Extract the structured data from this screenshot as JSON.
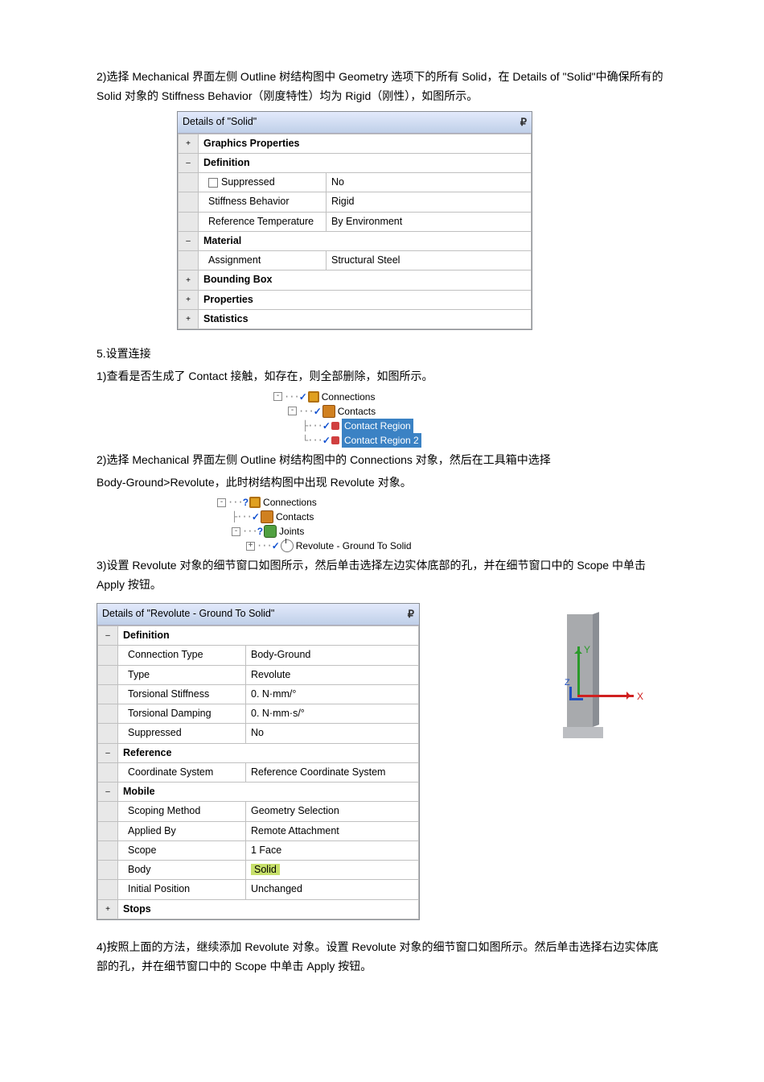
{
  "para1": "2)选择 Mechanical 界面左侧 Outline 树结构图中 Geometry 选项下的所有 Solid，在 Details of \"Solid\"中确保所有的 Solid 对象的 Stiffness Behavior（刚度特性）均为 Rigid（刚性），如图所示。",
  "panel1": {
    "title": "Details of \"Solid\"",
    "groups": {
      "graphics": "Graphics Properties",
      "definition": "Definition",
      "material": "Material",
      "bounding": "Bounding Box",
      "properties": "Properties",
      "statistics": "Statistics"
    },
    "rows": {
      "suppressed": {
        "label": "Suppressed",
        "val": "No"
      },
      "stiffness": {
        "label": "Stiffness Behavior",
        "val": "Rigid"
      },
      "reftemp": {
        "label": "Reference Temperature",
        "val": "By Environment"
      },
      "assignment": {
        "label": "Assignment",
        "val": "Structural Steel"
      }
    }
  },
  "heading5": "5.设置连接",
  "para5_1": "1)查看是否生成了 Contact 接触，如存在，则全部删除，如图所示。",
  "tree1": {
    "n1": "Connections",
    "n2": "Contacts",
    "n3": "Contact Region",
    "n4": "Contact Region 2"
  },
  "para5_2a": "2)选择 Mechanical 界面左侧 Outline 树结构图中的 Connections 对象，然后在工具箱中选择",
  "para5_2b": "Body-Ground>Revolute，此时树结构图中出现 Revolute 对象。",
  "tree2": {
    "n1": "Connections",
    "n2": "Contacts",
    "n3": "Joints",
    "n4": "Revolute - Ground To Solid"
  },
  "para5_3": "3)设置 Revolute 对象的细节窗口如图所示，然后单击选择左边实体底部的孔，并在细节窗口中的 Scope 中单击 Apply 按钮。",
  "panel2": {
    "title": "Details of \"Revolute - Ground To Solid\"",
    "groups": {
      "definition": "Definition",
      "reference": "Reference",
      "mobile": "Mobile",
      "stops": "Stops"
    },
    "rows": {
      "conntype": {
        "label": "Connection Type",
        "val": "Body-Ground"
      },
      "type": {
        "label": "Type",
        "val": "Revolute"
      },
      "torstiff": {
        "label": "Torsional Stiffness",
        "val": "0. N·mm/°"
      },
      "tordamp": {
        "label": "Torsional Damping",
        "val": "0. N·mm·s/°"
      },
      "suppressed": {
        "label": "Suppressed",
        "val": "No"
      },
      "coord": {
        "label": "Coordinate System",
        "val": "Reference Coordinate System"
      },
      "scopemethod": {
        "label": "Scoping Method",
        "val": "Geometry Selection"
      },
      "appliedby": {
        "label": "Applied By",
        "val": "Remote Attachment"
      },
      "scope": {
        "label": "Scope",
        "val": "1 Face"
      },
      "body": {
        "label": "Body",
        "val": "Solid"
      },
      "initpos": {
        "label": "Initial Position",
        "val": "Unchanged"
      }
    }
  },
  "axis": {
    "x": "X",
    "y": "Y",
    "z": "Z"
  },
  "para5_4": "4)按照上面的方法，继续添加 Revolute 对象。设置 Revolute 对象的细节窗口如图所示。然后单击选择右边实体底部的孔，并在细节窗口中的 Scope 中单击 Apply 按钮。",
  "glyphs": {
    "plus": "+",
    "minus": "–"
  }
}
